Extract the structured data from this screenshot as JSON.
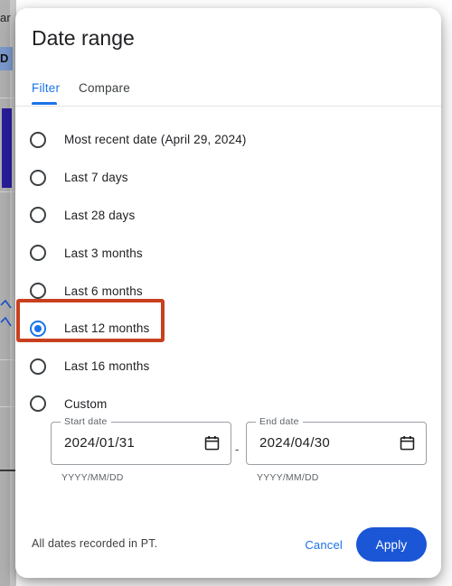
{
  "background": {
    "fragment_a": "ar",
    "fragment_b": "D"
  },
  "dialog": {
    "title": "Date range",
    "tabs": [
      {
        "label": "Filter",
        "active": true
      },
      {
        "label": "Compare",
        "active": false
      }
    ],
    "options": [
      {
        "label": "Most recent date (April 29, 2024)",
        "selected": false,
        "name": "most-recent-date"
      },
      {
        "label": "Last 7 days",
        "selected": false,
        "name": "last-7-days"
      },
      {
        "label": "Last 28 days",
        "selected": false,
        "name": "last-28-days"
      },
      {
        "label": "Last 3 months",
        "selected": false,
        "name": "last-3-months"
      },
      {
        "label": "Last 6 months",
        "selected": false,
        "name": "last-6-months"
      },
      {
        "label": "Last 12 months",
        "selected": true,
        "name": "last-12-months"
      },
      {
        "label": "Last 16 months",
        "selected": false,
        "name": "last-16-months"
      },
      {
        "label": "Custom",
        "selected": false,
        "name": "custom"
      }
    ],
    "date_fields": {
      "start": {
        "legend": "Start date",
        "value": "2024/01/31",
        "placeholder": "YYYY/MM/DD",
        "hint": "YYYY/MM/DD"
      },
      "separator": "-",
      "end": {
        "legend": "End date",
        "value": "2024/04/30",
        "placeholder": "YYYY/MM/DD",
        "hint": "YYYY/MM/DD"
      }
    },
    "footer": {
      "note": "All dates recorded in PT.",
      "cancel_label": "Cancel",
      "apply_label": "Apply"
    }
  },
  "colors": {
    "accent": "#1a73e8",
    "apply_button": "#1a56d6",
    "highlight_box": "#c8401f",
    "text_primary": "#202124",
    "text_secondary": "#5f6368",
    "backdrop": "#b3b3b3"
  }
}
